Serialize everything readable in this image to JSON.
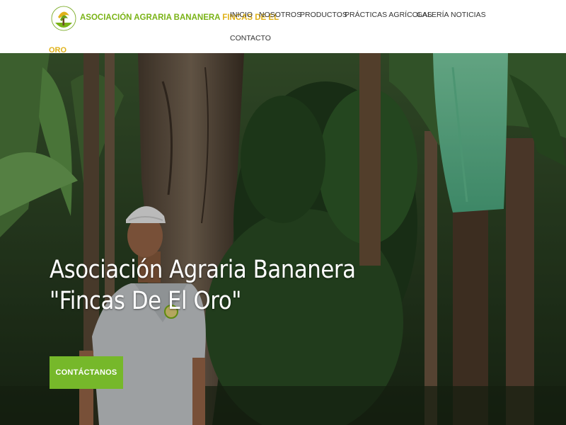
{
  "header": {
    "logo_icon": "association-seal-logo-icon",
    "brand": {
      "part1": "ASOCIACIÓN AGRARIA BANANERA ",
      "part2": "FINCAS DE EL",
      "part3": "ORO"
    },
    "nav": {
      "inicio": "INICIO",
      "nosotros": "NOSOTROS",
      "productos": "PRODUCTOS",
      "practicas": "PRÁCTICAS AGRÍCOLAS",
      "galeria": "GALERÍA",
      "noticias": "NOTICIAS",
      "contacto": "CONTACTO"
    }
  },
  "hero": {
    "title": "Asociación Agraria Bananera \"Fincas De El Oro\"",
    "cta_label": "CONTÁCTANOS"
  },
  "colors": {
    "brand_green": "#7ab317",
    "brand_gold": "#e0b21a",
    "cta_green": "#76b82a"
  }
}
